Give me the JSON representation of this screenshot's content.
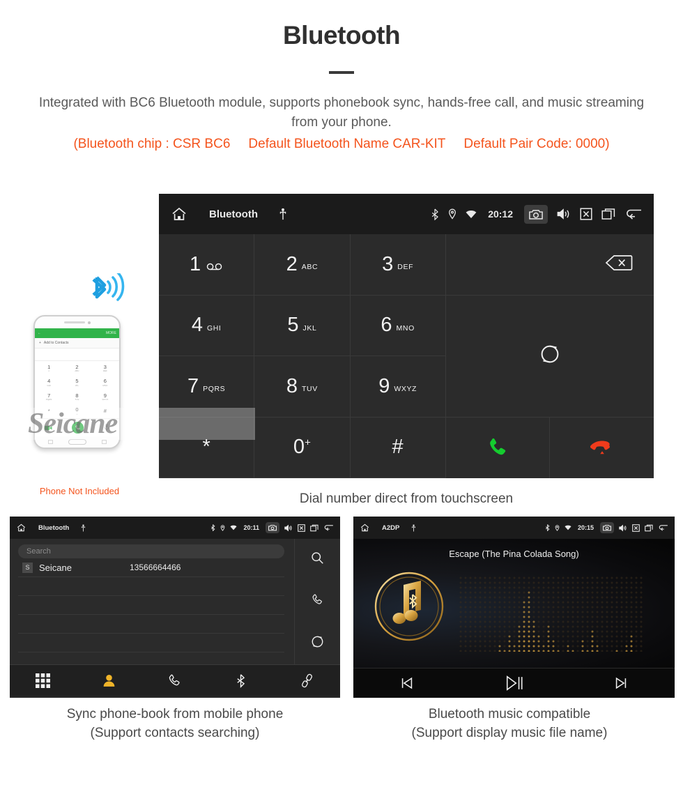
{
  "header": {
    "title": "Bluetooth",
    "lead": "Integrated with BC6 Bluetooth module, supports phonebook sync, hands-free call, and music streaming from your phone.",
    "spec_chip": "(Bluetooth chip : CSR BC6",
    "spec_name": "Default Bluetooth Name CAR-KIT",
    "spec_pair": "Default Pair Code: 0000)",
    "accent_color": "#f4541d",
    "title_color": "#303030"
  },
  "dialer": {
    "statusbar": {
      "home_icon": "home-icon",
      "title": "Bluetooth",
      "usb_icon": "usb-icon",
      "bluetooth_icon": "bluetooth-icon",
      "location_icon": "location-icon",
      "wifi_icon": "wifi-icon",
      "time": "20:12",
      "camera_icon": "camera-icon",
      "volume_icon": "volume-icon",
      "close_icon": "close-box-icon",
      "windows_icon": "recent-apps-icon",
      "back_icon": "back-arrow-icon"
    },
    "keys": [
      {
        "digit": "1",
        "letters": "",
        "voicemail": true
      },
      {
        "digit": "2",
        "letters": "ABC",
        "voicemail": false
      },
      {
        "digit": "3",
        "letters": "DEF",
        "voicemail": false
      },
      {
        "digit": "4",
        "letters": "GHI",
        "voicemail": false
      },
      {
        "digit": "5",
        "letters": "JKL",
        "voicemail": false
      },
      {
        "digit": "6",
        "letters": "MNO",
        "voicemail": false
      },
      {
        "digit": "7",
        "letters": "PQRS",
        "voicemail": false
      },
      {
        "digit": "8",
        "letters": "TUV",
        "voicemail": false
      },
      {
        "digit": "9",
        "letters": "WXYZ",
        "voicemail": false
      },
      {
        "digit": "*",
        "letters": "",
        "voicemail": false
      },
      {
        "digit": "0",
        "letters": "",
        "sup": "+",
        "voicemail": false
      },
      {
        "digit": "#",
        "letters": "",
        "voicemail": false
      }
    ],
    "number_input": "",
    "backspace_icon": "backspace-icon",
    "sync_icon": "sync-icon",
    "call_icon": "call-icon",
    "hangup_icon": "hangup-icon",
    "call_color": "#15cc2f",
    "hangup_color": "#ef3b1c",
    "navbar": [
      {
        "icon": "dialpad-icon",
        "active": true
      },
      {
        "icon": "contacts-icon",
        "active": false
      },
      {
        "icon": "call-log-icon",
        "active": false
      },
      {
        "icon": "bluetooth-icon",
        "active": false
      },
      {
        "icon": "pair-link-icon",
        "active": false
      }
    ],
    "active_color": "#f0b429",
    "caption": "Dial number direct from touchscreen"
  },
  "phone_mockup": {
    "header_more": "MORE",
    "back_icon": "back-arrow-icon",
    "add_label": "Add to Contacts",
    "keys": [
      {
        "digit": "1",
        "letters": "∞"
      },
      {
        "digit": "2",
        "letters": "ABC"
      },
      {
        "digit": "3",
        "letters": "DEF"
      },
      {
        "digit": "4",
        "letters": "GHI"
      },
      {
        "digit": "5",
        "letters": "JKL"
      },
      {
        "digit": "6",
        "letters": "MNO"
      },
      {
        "digit": "7",
        "letters": "PQRS"
      },
      {
        "digit": "8",
        "letters": "TUV"
      },
      {
        "digit": "9",
        "letters": "WXYZ"
      },
      {
        "digit": "*",
        "letters": ""
      },
      {
        "digit": "0",
        "letters": "+"
      },
      {
        "digit": "#",
        "letters": ""
      }
    ],
    "videocall_icon": "video-call-icon",
    "call_icon": "call-icon",
    "keyboard_icon": "keyboard-icon",
    "bluetooth_signal_icon": "bluetooth-signal-icon",
    "bluetooth_color": "#1e9fe0",
    "note": "Phone Not Included",
    "note_color": "#f4541d"
  },
  "watermark": {
    "text": "Seicane"
  },
  "phonebook": {
    "statusbar": {
      "home_icon": "home-icon",
      "title": "Bluetooth",
      "usb_icon": "usb-icon",
      "time": "20:11",
      "camera_icon": "camera-icon",
      "volume_icon": "volume-icon",
      "close_icon": "close-box-icon",
      "windows_icon": "recent-apps-icon",
      "back_icon": "back-arrow-icon"
    },
    "search_placeholder": "Search",
    "search_value": "",
    "contacts": [
      {
        "initial": "S",
        "name": "Seicane",
        "number": "13566664466"
      }
    ],
    "empty_rows": 4,
    "side_actions": [
      {
        "icon": "search-icon"
      },
      {
        "icon": "call-log-icon"
      },
      {
        "icon": "sync-icon"
      }
    ],
    "navbar": [
      {
        "icon": "dialpad-icon",
        "active": false
      },
      {
        "icon": "contacts-icon",
        "active": true
      },
      {
        "icon": "call-log-icon",
        "active": false
      },
      {
        "icon": "bluetooth-icon",
        "active": false
      },
      {
        "icon": "pair-link-icon",
        "active": false
      }
    ],
    "caption_line1": "Sync phone-book from mobile phone",
    "caption_line2": "(Support contacts searching)"
  },
  "music": {
    "statusbar": {
      "home_icon": "home-icon",
      "title": "A2DP",
      "usb_icon": "usb-icon",
      "time": "20:15",
      "camera_icon": "camera-icon",
      "volume_icon": "volume-icon",
      "close_icon": "close-box-icon",
      "windows_icon": "recent-apps-icon",
      "back_icon": "back-arrow-icon"
    },
    "track_title": "Escape (The Pina Colada Song)",
    "album_art_icon": "music-note-bluetooth-icon",
    "equalizer_icon": "equalizer-dots",
    "controls": [
      {
        "icon": "previous-track-icon"
      },
      {
        "icon": "play-pause-icon"
      },
      {
        "icon": "next-track-icon"
      }
    ],
    "gold_color": "#d9a441",
    "caption_line1": "Bluetooth music compatible",
    "caption_line2": "(Support display music file name)"
  }
}
